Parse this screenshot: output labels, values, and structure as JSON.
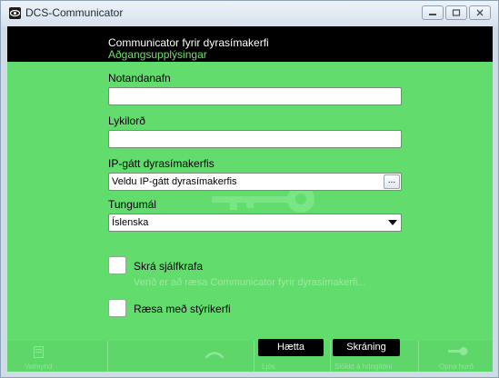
{
  "window": {
    "title": "DCS-Communicator"
  },
  "header": {
    "title": "Communicator fyrir dyrasímakerfi",
    "subtitle": "Aðgangsupplýsingar"
  },
  "form": {
    "username_label": "Notandanafn",
    "username_value": "",
    "password_label": "Lykilorð",
    "password_value": "",
    "gateway_label": "IP-gátt dyrasímakerfis",
    "gateway_value": "Veldu IP-gátt dyrasímakerfis",
    "browse_label": "...",
    "language_label": "Tungumál",
    "language_value": "Íslenska"
  },
  "options": {
    "auto_login_label": "Skrá sjálfkrafa",
    "auto_login_hint": "Verið er að ræsa Communicator fyrir dyrasímakerfi...",
    "start_with_os_label": "Ræsa með stýrikerfi"
  },
  "buttons": {
    "cancel_label": "Hætta",
    "login_label": "Skráning"
  },
  "footer": {
    "home_label": "Valmynd",
    "light_label": "Ljós",
    "ring_label": "Slökkt á hringitóni",
    "door_label": "Opna hurð"
  },
  "colors": {
    "background": "#62dd6d",
    "header": "#000000",
    "subtitle": "#6fe06b"
  }
}
